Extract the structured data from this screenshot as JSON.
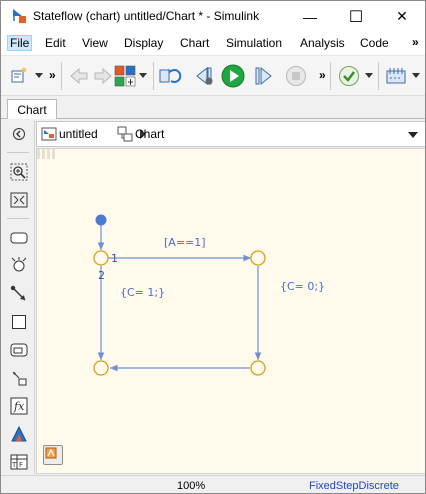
{
  "window": {
    "title": "Stateflow (chart) untitled/Chart * - Simulink",
    "minimize_glyph": "—",
    "maximize_glyph": "☐",
    "close_glyph": "✕"
  },
  "menu": {
    "items": [
      "File",
      "Edit",
      "View",
      "Display",
      "Chart",
      "Simulation",
      "Analysis",
      "Code"
    ],
    "more": "»"
  },
  "toolbar": {
    "more": "»",
    "icons": [
      "new-model-icon",
      "back-icon",
      "forward-icon",
      "library-browser-icon",
      "update-diagram-icon",
      "step-back-icon",
      "run-icon",
      "step-forward-icon",
      "stop-icon",
      "model-advisor-icon",
      "build-icon"
    ],
    "accent": "#1fa640"
  },
  "tabs": [
    {
      "label": "Chart"
    }
  ],
  "palette": {
    "tools": [
      "hide-show-icon",
      "zoom-in-icon",
      "fit-view-icon",
      "state-tool-icon",
      "history-junction-icon",
      "default-transition-icon",
      "box-tool-icon",
      "connective-junction-icon",
      "annotation-tool-icon",
      "function-tool-icon",
      "simulink-function-icon",
      "truth-table-icon"
    ]
  },
  "breadcrumb": {
    "model": "untitled",
    "chart": "Chart"
  },
  "chart": {
    "transition_condition": "[A==1]",
    "left_action": "{C= 1;}",
    "right_action": "{C= 0;}",
    "order_1": "1",
    "order_2": "2",
    "colors": {
      "canvas_bg": "#fffaeb",
      "junction_stroke": "#d4a017",
      "default_dot": "#4a7bd0",
      "transition": "#6e8fd6",
      "label": "#4a6bd0"
    }
  },
  "status": {
    "zoom": "100%",
    "solver": "FixedStepDiscrete"
  }
}
